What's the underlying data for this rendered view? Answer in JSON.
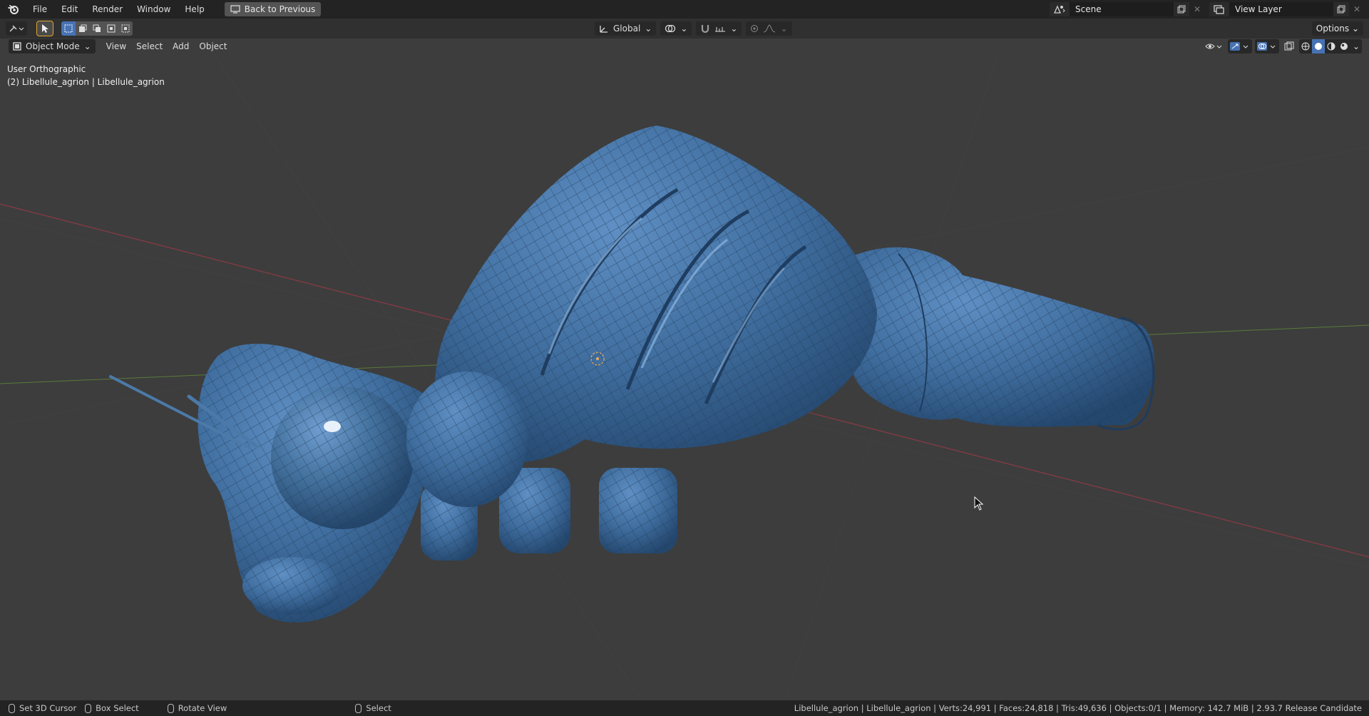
{
  "topbar": {
    "menus": [
      "File",
      "Edit",
      "Render",
      "Window",
      "Help"
    ],
    "back_label": "Back to Previous",
    "scene": "Scene",
    "view_layer": "View Layer"
  },
  "header": {
    "transform_orientation": "Global",
    "options_label": "Options"
  },
  "viewport_header": {
    "mode": "Object Mode",
    "menus": [
      "View",
      "Select",
      "Add",
      "Object"
    ]
  },
  "overlay": {
    "view_name": "User Orthographic",
    "object_info": "(2) Libellule_agrion | Libellule_agrion"
  },
  "statusbar": {
    "items": [
      "Set 3D Cursor",
      "Box Select",
      "Rotate View",
      "Select"
    ],
    "stats": "Libellule_agrion | Libellule_agrion | Verts:24,991 | Faces:24,818 | Tris:49,636 | Objects:0/1 | Memory: 142.7 MiB | 2.93.7 Release Candidate"
  },
  "colors": {
    "accent": "#4772b3",
    "mesh": "#3f6d9e",
    "background": "#3d3d3d"
  }
}
